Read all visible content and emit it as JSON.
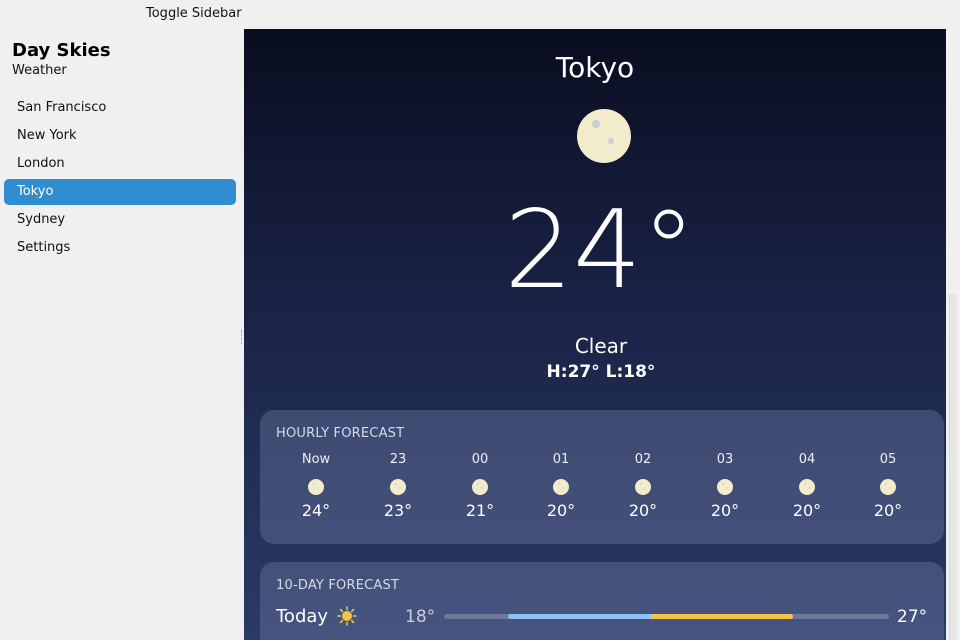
{
  "topbar": {
    "toggle_label": "Toggle Sidebar"
  },
  "sidebar": {
    "title": "Day Skies",
    "subtitle": "Weather",
    "items": [
      {
        "label": "San Francisco",
        "active": false
      },
      {
        "label": "New York",
        "active": false
      },
      {
        "label": "London",
        "active": false
      },
      {
        "label": "Tokyo",
        "active": true
      },
      {
        "label": "Sydney",
        "active": false
      },
      {
        "label": "Settings",
        "active": false
      }
    ]
  },
  "current": {
    "city": "Tokyo",
    "icon": "moon-icon",
    "temperature": "24°",
    "condition": "Clear",
    "hilo": "H:27° L:18°"
  },
  "hourly": {
    "title": "HOURLY FORECAST",
    "hours": [
      {
        "label": "Now",
        "icon": "moon-icon",
        "temp": "24°"
      },
      {
        "label": "23",
        "icon": "moon-icon",
        "temp": "23°"
      },
      {
        "label": "00",
        "icon": "moon-icon",
        "temp": "21°"
      },
      {
        "label": "01",
        "icon": "moon-icon",
        "temp": "20°"
      },
      {
        "label": "02",
        "icon": "moon-icon",
        "temp": "20°"
      },
      {
        "label": "03",
        "icon": "moon-icon",
        "temp": "20°"
      },
      {
        "label": "04",
        "icon": "moon-icon",
        "temp": "20°"
      },
      {
        "label": "05",
        "icon": "moon-icon",
        "temp": "20°"
      }
    ]
  },
  "daily": {
    "title": "10-DAY FORECAST",
    "days": [
      {
        "name": "Today",
        "icon": "sun-icon",
        "low": "18°",
        "high": "27°"
      }
    ]
  },
  "colors": {
    "accent": "#2f8cce",
    "sun": "#f4c542",
    "moon": "#f2ebcc",
    "range_cool": "#8cc1f2",
    "range_warm": "#f4c542"
  }
}
